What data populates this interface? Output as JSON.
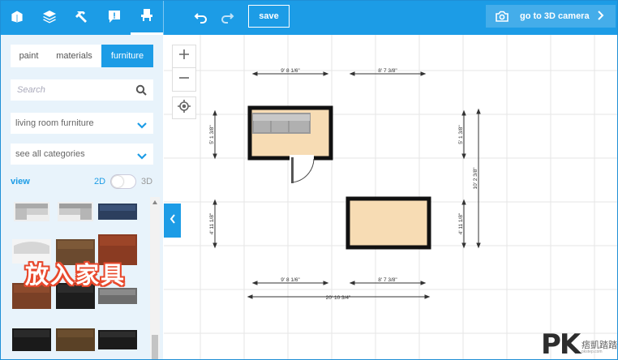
{
  "toolbar": {
    "tool_tabs": [
      "rooms-icon",
      "layers-icon",
      "hammer-icon",
      "comment-icon",
      "chair-icon"
    ],
    "save_label": "save",
    "camera_label": "go to 3D camera"
  },
  "sidebar": {
    "subtabs": [
      "paint",
      "materials",
      "furniture"
    ],
    "active_subtab": "furniture",
    "search_placeholder": "Search",
    "category_select": "living room furniture",
    "subcategory_select": "see all categories",
    "view_label": "view",
    "view_2d": "2D",
    "view_3d": "3D",
    "overlay_text": "放入家具"
  },
  "plan": {
    "top_dim_left": "9' 8 1/6\"",
    "top_dim_right": "8' 7 3/8\"",
    "left_dim_top": "5' 1 3/8\"",
    "left_dim_bottom": "4' 11 1/8\"",
    "right_dim_top": "5' 1 3/8\"",
    "right_dim_bottom": "4' 11 1/8\"",
    "right_dim_total": "10' 2 3/8\"",
    "bottom_dim_left": "9' 8 1/6\"",
    "bottom_dim_right": "8' 7 3/8\"",
    "bottom_dim_total": "20' 10 3/4\""
  },
  "watermark": {
    "logo": "PK",
    "line1": "痞凱踏踏",
    "line2": "pkstep.com"
  },
  "colors": {
    "accent": "#1c9ce6",
    "sidebar_bg": "#e8f3fb",
    "room_fill": "#f7dcb4",
    "wall": "#111111",
    "overlay_outline": "#e8482c"
  }
}
